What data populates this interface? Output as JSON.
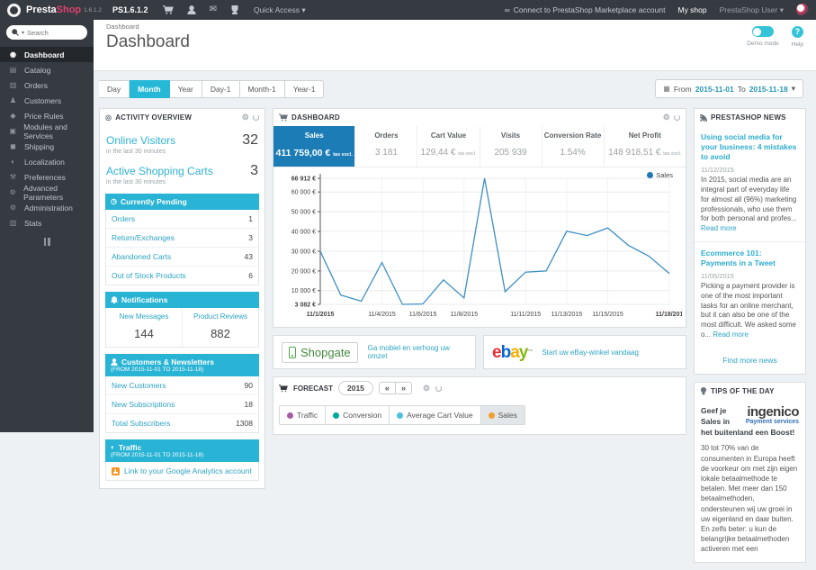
{
  "icons": {
    "dropdown": "▾",
    "envelope": "✉",
    "gear": "⚙",
    "clock": "◷",
    "activity": "◎",
    "globe": "◐",
    "bell_fallback": "◍",
    "calendar": "▦",
    "link": "∞",
    "help": "?",
    "prev": "«",
    "next": "»"
  },
  "topbar": {
    "brand_presta": "Presta",
    "brand_shop": "Shop",
    "brand_version": "1.6.1.2",
    "shop_version": "PS1.6.1.2",
    "quick_access": "Quick Access",
    "connect": "Connect to PrestaShop Marketplace account",
    "my_shop": "My shop",
    "user": "PrestaShop User"
  },
  "sidebar": {
    "search_placeholder": "Search",
    "items": [
      {
        "label": "Dashboard",
        "icon": "◉",
        "active": true
      },
      {
        "label": "Catalog",
        "icon": "▤"
      },
      {
        "label": "Orders",
        "icon": "▥"
      },
      {
        "label": "Customers",
        "icon": "♟"
      },
      {
        "label": "Price Rules",
        "icon": "◆"
      },
      {
        "label": "Modules and Services",
        "icon": "▣"
      },
      {
        "label": "Shipping",
        "icon": "◼"
      },
      {
        "label": "Localization",
        "icon": "◐"
      },
      {
        "label": "Preferences",
        "icon": "⚒"
      },
      {
        "label": "Advanced Parameters",
        "icon": "⚙"
      },
      {
        "label": "Administration",
        "icon": "⚙"
      },
      {
        "label": "Stats",
        "icon": "▥"
      }
    ]
  },
  "header": {
    "breadcrumb": "Dashboard",
    "title": "Dashboard",
    "demo_mode": "Demo mode",
    "help": "Help"
  },
  "toolbar": {
    "range_buttons": [
      {
        "label": "Day"
      },
      {
        "label": "Month",
        "active": true
      },
      {
        "label": "Year"
      },
      {
        "label": "Day-1"
      },
      {
        "label": "Month-1"
      },
      {
        "label": "Year-1"
      }
    ],
    "from_label": "From",
    "from_date": "2015-11-01",
    "to_label": "To",
    "to_date": "2015-11-18"
  },
  "activity": {
    "title": "ACTIVITY OVERVIEW",
    "online_visitors_label": "Online Visitors",
    "online_visitors_value": "32",
    "online_visitors_sub": "in the last 30 minutes",
    "active_carts_label": "Active Shopping Carts",
    "active_carts_value": "3",
    "active_carts_sub": "in the last 30 minutes",
    "pending_title": "Currently Pending",
    "pending_rows": [
      {
        "label": "Orders",
        "value": "1"
      },
      {
        "label": "Return/Exchanges",
        "value": "3"
      },
      {
        "label": "Abandoned Carts",
        "value": "43"
      },
      {
        "label": "Out of Stock Products",
        "value": "6"
      }
    ],
    "notifications_title": "Notifications",
    "notification_cols": [
      {
        "label": "New Messages",
        "value": "144"
      },
      {
        "label": "Product Reviews",
        "value": "882"
      }
    ],
    "customers_title": "Customers & Newsletters",
    "customers_sub": "(FROM 2015-11-01 TO 2015-11-18)",
    "customers_rows": [
      {
        "label": "New Customers",
        "value": "90"
      },
      {
        "label": "New Subscriptions",
        "value": "18"
      },
      {
        "label": "Total Subscribers",
        "value": "1308"
      }
    ],
    "traffic_title": "Traffic",
    "traffic_sub": "(FROM 2015-11-01 TO 2015-11-18)",
    "ga_link": "Link to your Google Analytics account"
  },
  "dashboard_panel": {
    "title": "DASHBOARD",
    "metrics": [
      {
        "label": "Sales",
        "value": "411 759,00 €",
        "suffix": "tax excl.",
        "active": true,
        "big": true
      },
      {
        "label": "Orders",
        "value": "3 181"
      },
      {
        "label": "Cart Value",
        "value": "129,44 €",
        "suffix": "tax excl."
      },
      {
        "label": "Visits",
        "value": "205 939"
      },
      {
        "label": "Conversion Rate",
        "value": "1.54%"
      },
      {
        "label": "Net Profit",
        "value": "148 918,51 €",
        "suffix": "tax excl.",
        "big": true
      }
    ]
  },
  "chart_data": {
    "type": "line",
    "title": "Sales by day",
    "x": [
      "11/1/2015",
      "11/2/2015",
      "11/3/2015",
      "11/4/2015",
      "11/5/2015",
      "11/6/2015",
      "11/7/2015",
      "11/8/2015",
      "11/9/2015",
      "11/10/2015",
      "11/11/2015",
      "11/12/2015",
      "11/13/2015",
      "11/14/2015",
      "11/15/2015",
      "11/16/2015",
      "11/17/2015",
      "11/18/2015"
    ],
    "series": [
      {
        "name": "Sales",
        "color": "#3d8fc4",
        "values": [
          30000,
          7800,
          4700,
          24300,
          3082,
          3300,
          15500,
          6300,
          66912,
          9500,
          19400,
          20000,
          40100,
          37900,
          41800,
          33000,
          27500,
          18700
        ]
      }
    ],
    "ylim": [
      3082,
      66912
    ],
    "y_ticks": [
      {
        "v": 66912,
        "label": "66 912 €",
        "bold": true
      },
      {
        "v": 60000,
        "label": "60 000 €"
      },
      {
        "v": 50000,
        "label": "50 000 €"
      },
      {
        "v": 40000,
        "label": "40 000 €"
      },
      {
        "v": 30000,
        "label": "30 000 €"
      },
      {
        "v": 20000,
        "label": "20 000 €"
      },
      {
        "v": 10000,
        "label": "10 000 €"
      },
      {
        "v": 3082,
        "label": "3 082 €",
        "bold": true
      }
    ],
    "x_ticks": [
      {
        "i": 0,
        "label": "11/1/2015",
        "bold": true
      },
      {
        "i": 3,
        "label": "11/4/2015"
      },
      {
        "i": 5,
        "label": "11/6/2015"
      },
      {
        "i": 7,
        "label": "11/8/2015"
      },
      {
        "i": 10,
        "label": "11/11/2015"
      },
      {
        "i": 12,
        "label": "11/13/2015"
      },
      {
        "i": 14,
        "label": "11/15/2015"
      },
      {
        "i": 17,
        "label": "11/18/201",
        "bold": true
      }
    ],
    "legend": "Sales",
    "legend_dot_color": "#1f77b4",
    "grid": true,
    "legend_position": "top-right"
  },
  "banners": {
    "shopgate_name": "Shopgate",
    "shopgate_link": "Ga mobiel en verhoog uw omzet",
    "ebay_letters": [
      {
        "ch": "e",
        "color": "#e53238"
      },
      {
        "ch": "b",
        "color": "#0064d2"
      },
      {
        "ch": "a",
        "color": "#f5af02"
      },
      {
        "ch": "y",
        "color": "#86b817"
      }
    ],
    "ebay_tm": "™",
    "ebay_link": "Start uw eBay-winkel vandaag"
  },
  "forecast": {
    "title": "FORECAST",
    "year": "2015",
    "tabs": [
      {
        "label": "Traffic",
        "color": "#a55ca5"
      },
      {
        "label": "Conversion",
        "color": "#00a89c"
      },
      {
        "label": "Average Cart Value",
        "color": "#4bc0e0"
      },
      {
        "label": "Sales",
        "color": "#f0a030",
        "active": true
      }
    ]
  },
  "news": {
    "title": "PRESTASHOP NEWS",
    "articles": [
      {
        "title": "Using social media for your business: 4 mistakes to avoid",
        "date": "11/12/2015",
        "body": "In 2015, social media are an integral part of everyday life for almost all (96%) marketing professionals, who use them for both personal and profes...",
        "more": "Read more"
      },
      {
        "title": "Ecommerce 101: Payments in a Tweet",
        "date": "11/05/2015",
        "body": "Picking a payment provider is one of the most important tasks for an online merchant, but it can also be one of the most difficult. We asked some o...",
        "more": "Read more"
      }
    ],
    "find_more": "Find more news"
  },
  "tips": {
    "title": "TIPS OF THE DAY",
    "heading": "Geef je Sales in het buitenland een Boost!",
    "logo_main": "ingenico",
    "logo_sub": "Payment services",
    "body": "30 tot 70% van de consumenten in Europa heeft de voorkeur om met zijn eigen lokale betaalmethode te betalen. Met meer dan 150 betaalmethoden, ondersteunen wij uw groei in uw eigenland en daar buiten. En zelfs beter: u kun de belangrijke betaalmethoden activeren met een"
  }
}
